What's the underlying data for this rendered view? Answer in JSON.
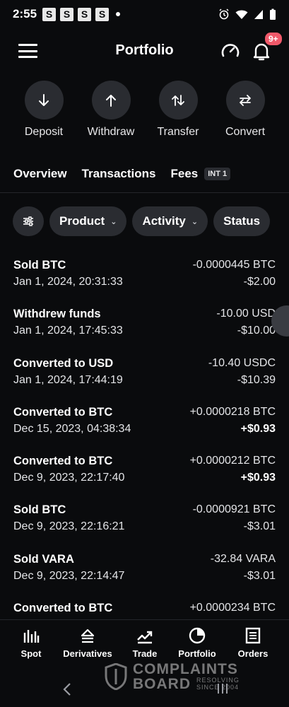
{
  "status_bar": {
    "time": "2:55",
    "notification_letters": [
      "S",
      "S",
      "S",
      "S"
    ]
  },
  "header": {
    "title": "Portfolio",
    "notification_count": "9+"
  },
  "actions": [
    {
      "label": "Deposit",
      "icon": "arrow-down-icon"
    },
    {
      "label": "Withdraw",
      "icon": "arrow-up-icon"
    },
    {
      "label": "Transfer",
      "icon": "transfer-icon"
    },
    {
      "label": "Convert",
      "icon": "convert-icon"
    }
  ],
  "tabs": {
    "overview": "Overview",
    "transactions": "Transactions",
    "fees": "Fees",
    "fees_badge": "INT 1"
  },
  "filters": {
    "product": "Product",
    "activity": "Activity",
    "status": "Status"
  },
  "transactions": [
    {
      "title": "Sold BTC",
      "date": "Jan 1, 2024, 20:31:33",
      "amount": "-0.0000445 BTC",
      "usd": "-$2.00",
      "positive": false
    },
    {
      "title": "Withdrew funds",
      "date": "Jan 1, 2024, 17:45:33",
      "amount": "-10.00 USD",
      "usd": "-$10.00",
      "positive": false
    },
    {
      "title": "Converted to USD",
      "date": "Jan 1, 2024, 17:44:19",
      "amount": "-10.40 USDC",
      "usd": "-$10.39",
      "positive": false
    },
    {
      "title": "Converted to BTC",
      "date": "Dec 15, 2023, 04:38:34",
      "amount": "+0.0000218 BTC",
      "usd": "+$0.93",
      "positive": true
    },
    {
      "title": "Converted to BTC",
      "date": "Dec 9, 2023, 22:17:40",
      "amount": "+0.0000212 BTC",
      "usd": "+$0.93",
      "positive": true
    },
    {
      "title": "Sold BTC",
      "date": "Dec 9, 2023, 22:16:21",
      "amount": "-0.0000921 BTC",
      "usd": "-$3.01",
      "positive": false
    },
    {
      "title": "Sold VARA",
      "date": "Dec 9, 2023, 22:14:47",
      "amount": "-32.84 VARA",
      "usd": "-$3.01",
      "positive": false
    },
    {
      "title": "Converted to BTC",
      "date": "",
      "amount": "+0.0000234 BTC",
      "usd": "",
      "positive": true
    }
  ],
  "bottom_nav": [
    {
      "label": "Spot",
      "icon": "bar-chart-icon"
    },
    {
      "label": "Derivatives",
      "icon": "derivatives-icon"
    },
    {
      "label": "Trade",
      "icon": "trend-icon"
    },
    {
      "label": "Portfolio",
      "icon": "pie-chart-icon"
    },
    {
      "label": "Orders",
      "icon": "orders-icon"
    }
  ],
  "watermark": {
    "line1": "COMPLAINTS",
    "line2": "BOARD",
    "sub1": "RESOLVING",
    "sub2": "SINCE 2004"
  }
}
